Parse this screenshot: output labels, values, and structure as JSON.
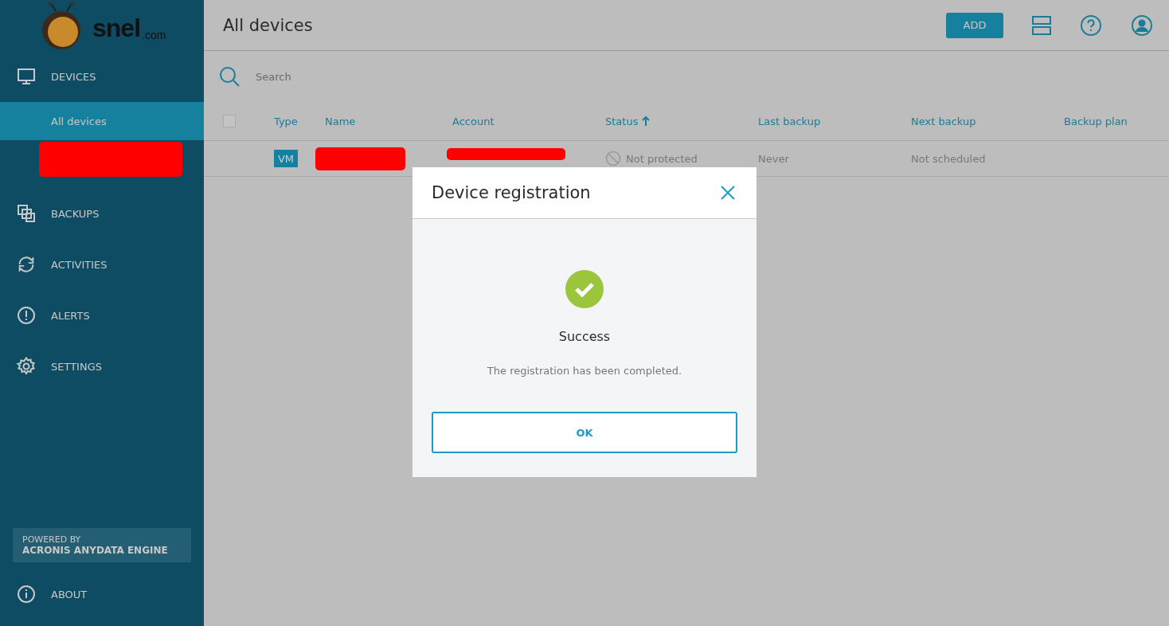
{
  "brand": {
    "name": "snel",
    "suffix": ".com"
  },
  "sidebar": {
    "items": [
      {
        "label": "DEVICES",
        "selected": false,
        "children": [
          {
            "label": "All devices",
            "selected": true
          },
          {
            "kind": "redacted"
          }
        ]
      },
      {
        "label": "BACKUPS",
        "selected": false
      },
      {
        "label": "ACTIVITIES",
        "selected": false
      },
      {
        "label": "ALERTS",
        "selected": false
      },
      {
        "label": "SETTINGS",
        "selected": false
      }
    ],
    "powered": {
      "line1": "POWERED BY",
      "line2": "ACRONIS ANYDATA ENGINE"
    },
    "about": {
      "label": "ABOUT"
    }
  },
  "header": {
    "title": "All devices",
    "add_button": "ADD"
  },
  "search": {
    "placeholder": "Search"
  },
  "table": {
    "select_all_checked": false,
    "columns": [
      {
        "label": "Type"
      },
      {
        "label": "Name"
      },
      {
        "label": "Account"
      },
      {
        "label": "Status",
        "sorted": true
      },
      {
        "label": "Last backup"
      },
      {
        "label": "Next backup"
      },
      {
        "label": "Backup plan"
      }
    ],
    "rows": [
      {
        "type": "VM",
        "name_redacted": true,
        "account_redacted": true,
        "status": "Not protected",
        "last_backup": "Never",
        "next_backup": "Not scheduled"
      }
    ]
  },
  "dialog": {
    "title": "Device registration",
    "heading": "Success",
    "message": "The registration has been completed.",
    "ok_button": "OK"
  }
}
